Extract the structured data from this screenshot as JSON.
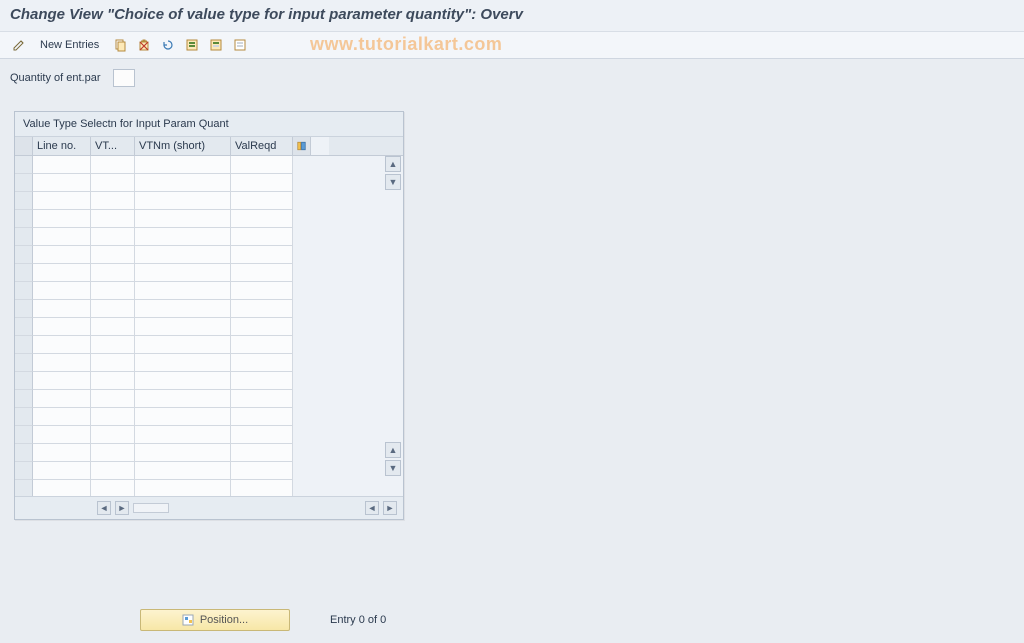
{
  "title": "Change View \"Choice of value type for input parameter quantity\": Overv",
  "toolbar": {
    "new_entries_label": "New Entries"
  },
  "watermark": "www.tutorialkart.com",
  "field": {
    "label": "Quantity of ent.par",
    "value": ""
  },
  "panel": {
    "title": "Value Type Selectn for Input Param Quant",
    "columns": {
      "line_no": "Line no.",
      "vt": "VT...",
      "vtnm_short": "VTNm (short)",
      "val_reqd": "ValReqd"
    },
    "rows": [
      {},
      {},
      {},
      {},
      {},
      {},
      {},
      {},
      {},
      {},
      {},
      {},
      {},
      {},
      {},
      {},
      {},
      {},
      {}
    ]
  },
  "footer": {
    "position_label": "Position...",
    "entry_text": "Entry 0 of 0"
  },
  "icons": {
    "configure": "configure-columns-icon"
  }
}
